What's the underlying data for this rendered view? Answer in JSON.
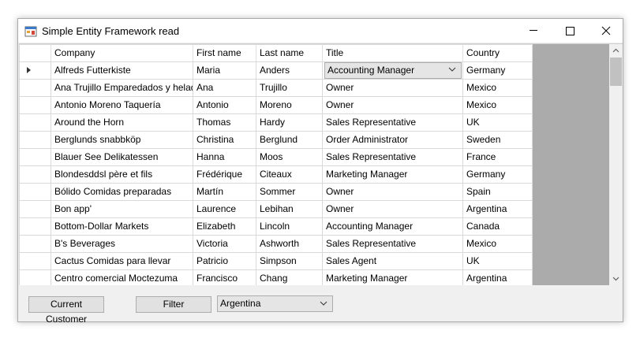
{
  "window": {
    "title": "Simple Entity Framework read",
    "icon": "app-window-icon"
  },
  "grid": {
    "columns": [
      "Company",
      "First name",
      "Last name",
      "Title",
      "Country"
    ],
    "current_row": 0,
    "rows": [
      [
        "Alfreds Futterkiste",
        "Maria",
        "Anders",
        "Accounting Manager",
        "Germany"
      ],
      [
        "Ana Trujillo Emparedados y helados",
        "Ana",
        "Trujillo",
        "Owner",
        "Mexico"
      ],
      [
        "Antonio Moreno Taquería",
        "Antonio",
        "Moreno",
        "Owner",
        "Mexico"
      ],
      [
        "Around the Horn",
        "Thomas",
        "Hardy",
        "Sales Representative",
        "UK"
      ],
      [
        "Berglunds snabbköp",
        "Christina",
        "Berglund",
        "Order Administrator",
        "Sweden"
      ],
      [
        "Blauer See Delikatessen",
        "Hanna",
        "Moos",
        "Sales Representative",
        "France"
      ],
      [
        "Blondesddsl père et fils",
        "Frédérique",
        "Citeaux",
        "Marketing Manager",
        "Germany"
      ],
      [
        "Bólido Comidas preparadas",
        "Martín",
        "Sommer",
        "Owner",
        "Spain"
      ],
      [
        "Bon app'",
        "Laurence",
        "Lebihan",
        "Owner",
        "Argentina"
      ],
      [
        "Bottom-Dollar Markets",
        "Elizabeth",
        "Lincoln",
        "Accounting Manager",
        "Canada"
      ],
      [
        "B's Beverages",
        "Victoria",
        "Ashworth",
        "Sales Representative",
        "Mexico"
      ],
      [
        "Cactus Comidas para llevar",
        "Patricio",
        "Simpson",
        "Sales Agent",
        "UK"
      ],
      [
        "Centro comercial Moctezuma",
        "Francisco",
        "Chang",
        "Marketing Manager",
        "Argentina"
      ]
    ]
  },
  "controls": {
    "current_customer_label": "Current Customer",
    "filter_label": "Filter",
    "filter_selected": "Argentina"
  }
}
